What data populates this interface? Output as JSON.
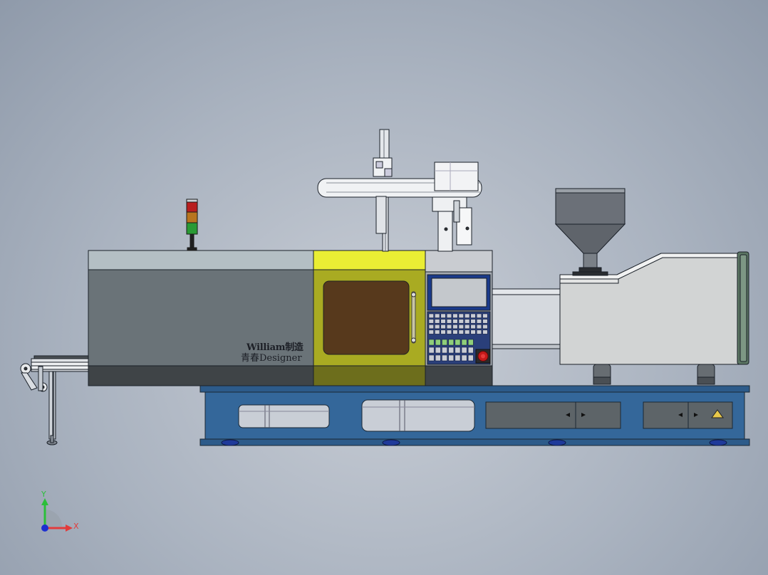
{
  "model": {
    "brand_line1": "William制造",
    "brand_line2": "青春Designer"
  },
  "triad": {
    "x_label": "X",
    "y_label": "Y"
  },
  "colors": {
    "background": "#a3adba",
    "base_frame": "#2f5f8f",
    "clamp_unit": "#6a7377",
    "guard_door": "#d7d93a",
    "window": "#5a3a1e",
    "barrel_housing": "#cfd0d0",
    "hopper": "#6b7078",
    "signal_red": "#b81e1e",
    "signal_amber": "#b8741e",
    "signal_green": "#2a9a34"
  }
}
